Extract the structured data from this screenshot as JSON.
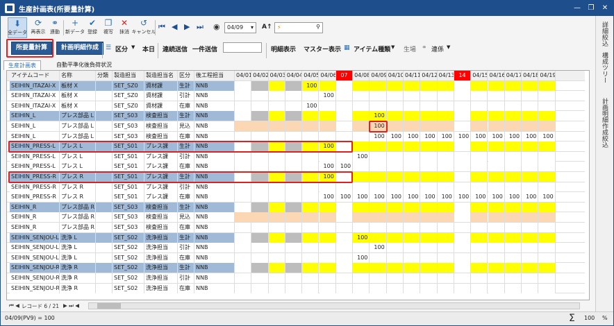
{
  "window": {
    "title": "生産計画表(所要量計算)"
  },
  "toolbar": {
    "buttons": [
      {
        "label": "全データ",
        "icon": "download-icon"
      },
      {
        "label": "再表示",
        "icon": "refresh-icon"
      },
      {
        "label": "連動",
        "icon": "link-icon"
      },
      {
        "label": "新データ",
        "icon": "plus-icon"
      },
      {
        "label": "登録",
        "icon": "check-icon"
      },
      {
        "label": "複写",
        "icon": "copy-icon"
      },
      {
        "label": "抹消",
        "icon": "close-icon"
      },
      {
        "label": "キャンセル",
        "icon": "undo-icon"
      }
    ],
    "date_value": "04/09",
    "font_label": "A↑",
    "search_value": ""
  },
  "toolbar2": {
    "calc_button": "所要量計算",
    "plan_button": "計画明細作成",
    "division": "区分",
    "today": "本日",
    "continuous_send": "連続送信",
    "single_send": "一件送信",
    "send_input": "",
    "detail_view": "明細表示",
    "master_view": "マスター表示",
    "item_type": "アイテム種類",
    "production": "生場",
    "link": "連係"
  },
  "tabs": [
    "生産計画表",
    "自動平準化後負荷状況"
  ],
  "columns": [
    "アイテムコード",
    "名称",
    "分類",
    "製造担当",
    "製造担当名",
    "区分",
    "後工程担当"
  ],
  "dates": [
    "04/01",
    "04/02",
    "04/03",
    "04/04",
    "04/05",
    "04/06",
    "07",
    "04/08",
    "04/09",
    "04/10",
    "04/11",
    "04/12",
    "04/13",
    "14",
    "04/15",
    "04/16",
    "04/17",
    "04/18",
    "04/19"
  ],
  "rows": [
    {
      "code": "SEIHIN_ITAZAI-X",
      "name": "板材 X",
      "cls": "",
      "mfg": "SET_SZ0",
      "mfgname": "資材課",
      "kubun": "生計",
      "next": "NNB",
      "type": "plan",
      "vals": {
        "4": "100"
      }
    },
    {
      "code": "SEIHIN_ITAZAI-X",
      "name": "板材 X",
      "cls": "",
      "mfg": "SET_SZ0",
      "mfgname": "資材課",
      "kubun": "引計",
      "next": "NNB",
      "type": "sub",
      "vals": {
        "5": "100"
      }
    },
    {
      "code": "SEIHIN_ITAZAI-X",
      "name": "板材 X",
      "cls": "",
      "mfg": "SET_SZ0",
      "mfgname": "資材課",
      "kubun": "在庫",
      "next": "NNB",
      "type": "sub",
      "vals": {
        "4": "100"
      }
    },
    {
      "code": "SEIHIN_L",
      "name": "プレス部品 L",
      "cls": "",
      "mfg": "SET_S03",
      "mfgname": "検査担当",
      "kubun": "生計",
      "next": "NNB",
      "type": "plan",
      "vals": {
        "8": "100"
      }
    },
    {
      "code": "SEIHIN_L",
      "name": "プレス部品 L",
      "cls": "",
      "mfg": "SET_S03",
      "mfgname": "検査担当",
      "kubun": "見込",
      "next": "NNB",
      "type": "fore",
      "vals": {
        "8": "100"
      }
    },
    {
      "code": "SEIHIN_L",
      "name": "プレス部品 L",
      "cls": "",
      "mfg": "SET_S03",
      "mfgname": "検査担当",
      "kubun": "在庫",
      "next": "NNB",
      "type": "sub",
      "vals": {
        "8": "100",
        "9": "100",
        "10": "100",
        "11": "100",
        "12": "100",
        "13": "100",
        "14": "100",
        "15": "100",
        "16": "100",
        "17": "100",
        "18": "100"
      }
    },
    {
      "code": "SEIHIN_PRESS-L",
      "name": "プレス L",
      "cls": "",
      "mfg": "SET_S01",
      "mfgname": "プレス課",
      "kubun": "生計",
      "next": "NNB",
      "type": "plan",
      "vals": {
        "5": "100"
      }
    },
    {
      "code": "SEIHIN_PRESS-L",
      "name": "プレス L",
      "cls": "",
      "mfg": "SET_S01",
      "mfgname": "プレス課",
      "kubun": "引計",
      "next": "NNB",
      "type": "sub",
      "vals": {
        "7": "100"
      }
    },
    {
      "code": "SEIHIN_PRESS-L",
      "name": "プレス L",
      "cls": "",
      "mfg": "SET_S01",
      "mfgname": "プレス課",
      "kubun": "在庫",
      "next": "NNB",
      "type": "sub",
      "vals": {
        "5": "100",
        "6": "100"
      }
    },
    {
      "code": "SEIHIN_PRESS-R",
      "name": "プレス R",
      "cls": "",
      "mfg": "SET_S01",
      "mfgname": "プレス課",
      "kubun": "生計",
      "next": "NNB",
      "type": "plan",
      "vals": {
        "5": "100"
      }
    },
    {
      "code": "SEIHIN_PRESS-R",
      "name": "プレス R",
      "cls": "",
      "mfg": "SET_S01",
      "mfgname": "プレス課",
      "kubun": "引計",
      "next": "NNB",
      "type": "sub",
      "vals": {}
    },
    {
      "code": "SEIHIN_PRESS-R",
      "name": "プレス R",
      "cls": "",
      "mfg": "SET_S01",
      "mfgname": "プレス課",
      "kubun": "在庫",
      "next": "NNB",
      "type": "sub",
      "vals": {
        "5": "100",
        "6": "100",
        "7": "100",
        "8": "100",
        "9": "100",
        "10": "100",
        "11": "100",
        "12": "100",
        "13": "100",
        "14": "100",
        "15": "100",
        "16": "100",
        "17": "100",
        "18": "100"
      }
    },
    {
      "code": "SEIHIN_R",
      "name": "プレス部品 R",
      "cls": "",
      "mfg": "SET_S03",
      "mfgname": "検査担当",
      "kubun": "生計",
      "next": "NNB",
      "type": "plan",
      "vals": {}
    },
    {
      "code": "SEIHIN_R",
      "name": "プレス部品 R",
      "cls": "",
      "mfg": "SET_S03",
      "mfgname": "検査担当",
      "kubun": "見込",
      "next": "NNB",
      "type": "fore",
      "vals": {}
    },
    {
      "code": "SEIHIN_R",
      "name": "プレス部品 R",
      "cls": "",
      "mfg": "SET_S03",
      "mfgname": "検査担当",
      "kubun": "在庫",
      "next": "NNB",
      "type": "sub",
      "vals": {}
    },
    {
      "code": "SEIHIN_SENJOU-L",
      "name": "洗浄 L",
      "cls": "",
      "mfg": "SET_S02",
      "mfgname": "洗浄担当",
      "kubun": "生計",
      "next": "NNB",
      "type": "plan",
      "vals": {
        "7": "100"
      }
    },
    {
      "code": "SEIHIN_SENJOU-L",
      "name": "洗浄 L",
      "cls": "",
      "mfg": "SET_S02",
      "mfgname": "洗浄担当",
      "kubun": "引計",
      "next": "NNB",
      "type": "sub",
      "vals": {
        "8": "100"
      }
    },
    {
      "code": "SEIHIN_SENJOU-L",
      "name": "洗浄 L",
      "cls": "",
      "mfg": "SET_S02",
      "mfgname": "洗浄担当",
      "kubun": "在庫",
      "next": "NNB",
      "type": "sub",
      "vals": {
        "7": "100"
      }
    },
    {
      "code": "SEIHIN_SENJOU-R",
      "name": "洗浄 R",
      "cls": "",
      "mfg": "SET_S02",
      "mfgname": "洗浄担当",
      "kubun": "生計",
      "next": "NNB",
      "type": "plan",
      "vals": {}
    },
    {
      "code": "SEIHIN_SENJOU-R",
      "name": "洗浄 R",
      "cls": "",
      "mfg": "SET_S02",
      "mfgname": "洗浄担当",
      "kubun": "引計",
      "next": "NNB",
      "type": "sub",
      "vals": {}
    },
    {
      "code": "SEIHIN_SENJOU-R",
      "name": "洗浄 R",
      "cls": "",
      "mfg": "SET_S02",
      "mfgname": "洗浄担当",
      "kubun": "在庫",
      "next": "NNB",
      "type": "sub",
      "vals": {}
    }
  ],
  "footer": {
    "record": "レコード 6 / 21"
  },
  "status": {
    "left": "04/09(PV9) = 100",
    "sigma": "Σ",
    "zoom": "100",
    "pct": "%"
  },
  "right_panel": [
    "詳細絞込",
    "構成ツリー",
    "計画明細作成絞込"
  ],
  "colors": {
    "title": "#1f4e8c",
    "plan_row": "#9fb9d7",
    "yellow": "#ffff00",
    "forecast": "#fbd7b4",
    "gray": "#bdbdbd",
    "holiday": "#ff0000",
    "highlight": "#e02020"
  }
}
